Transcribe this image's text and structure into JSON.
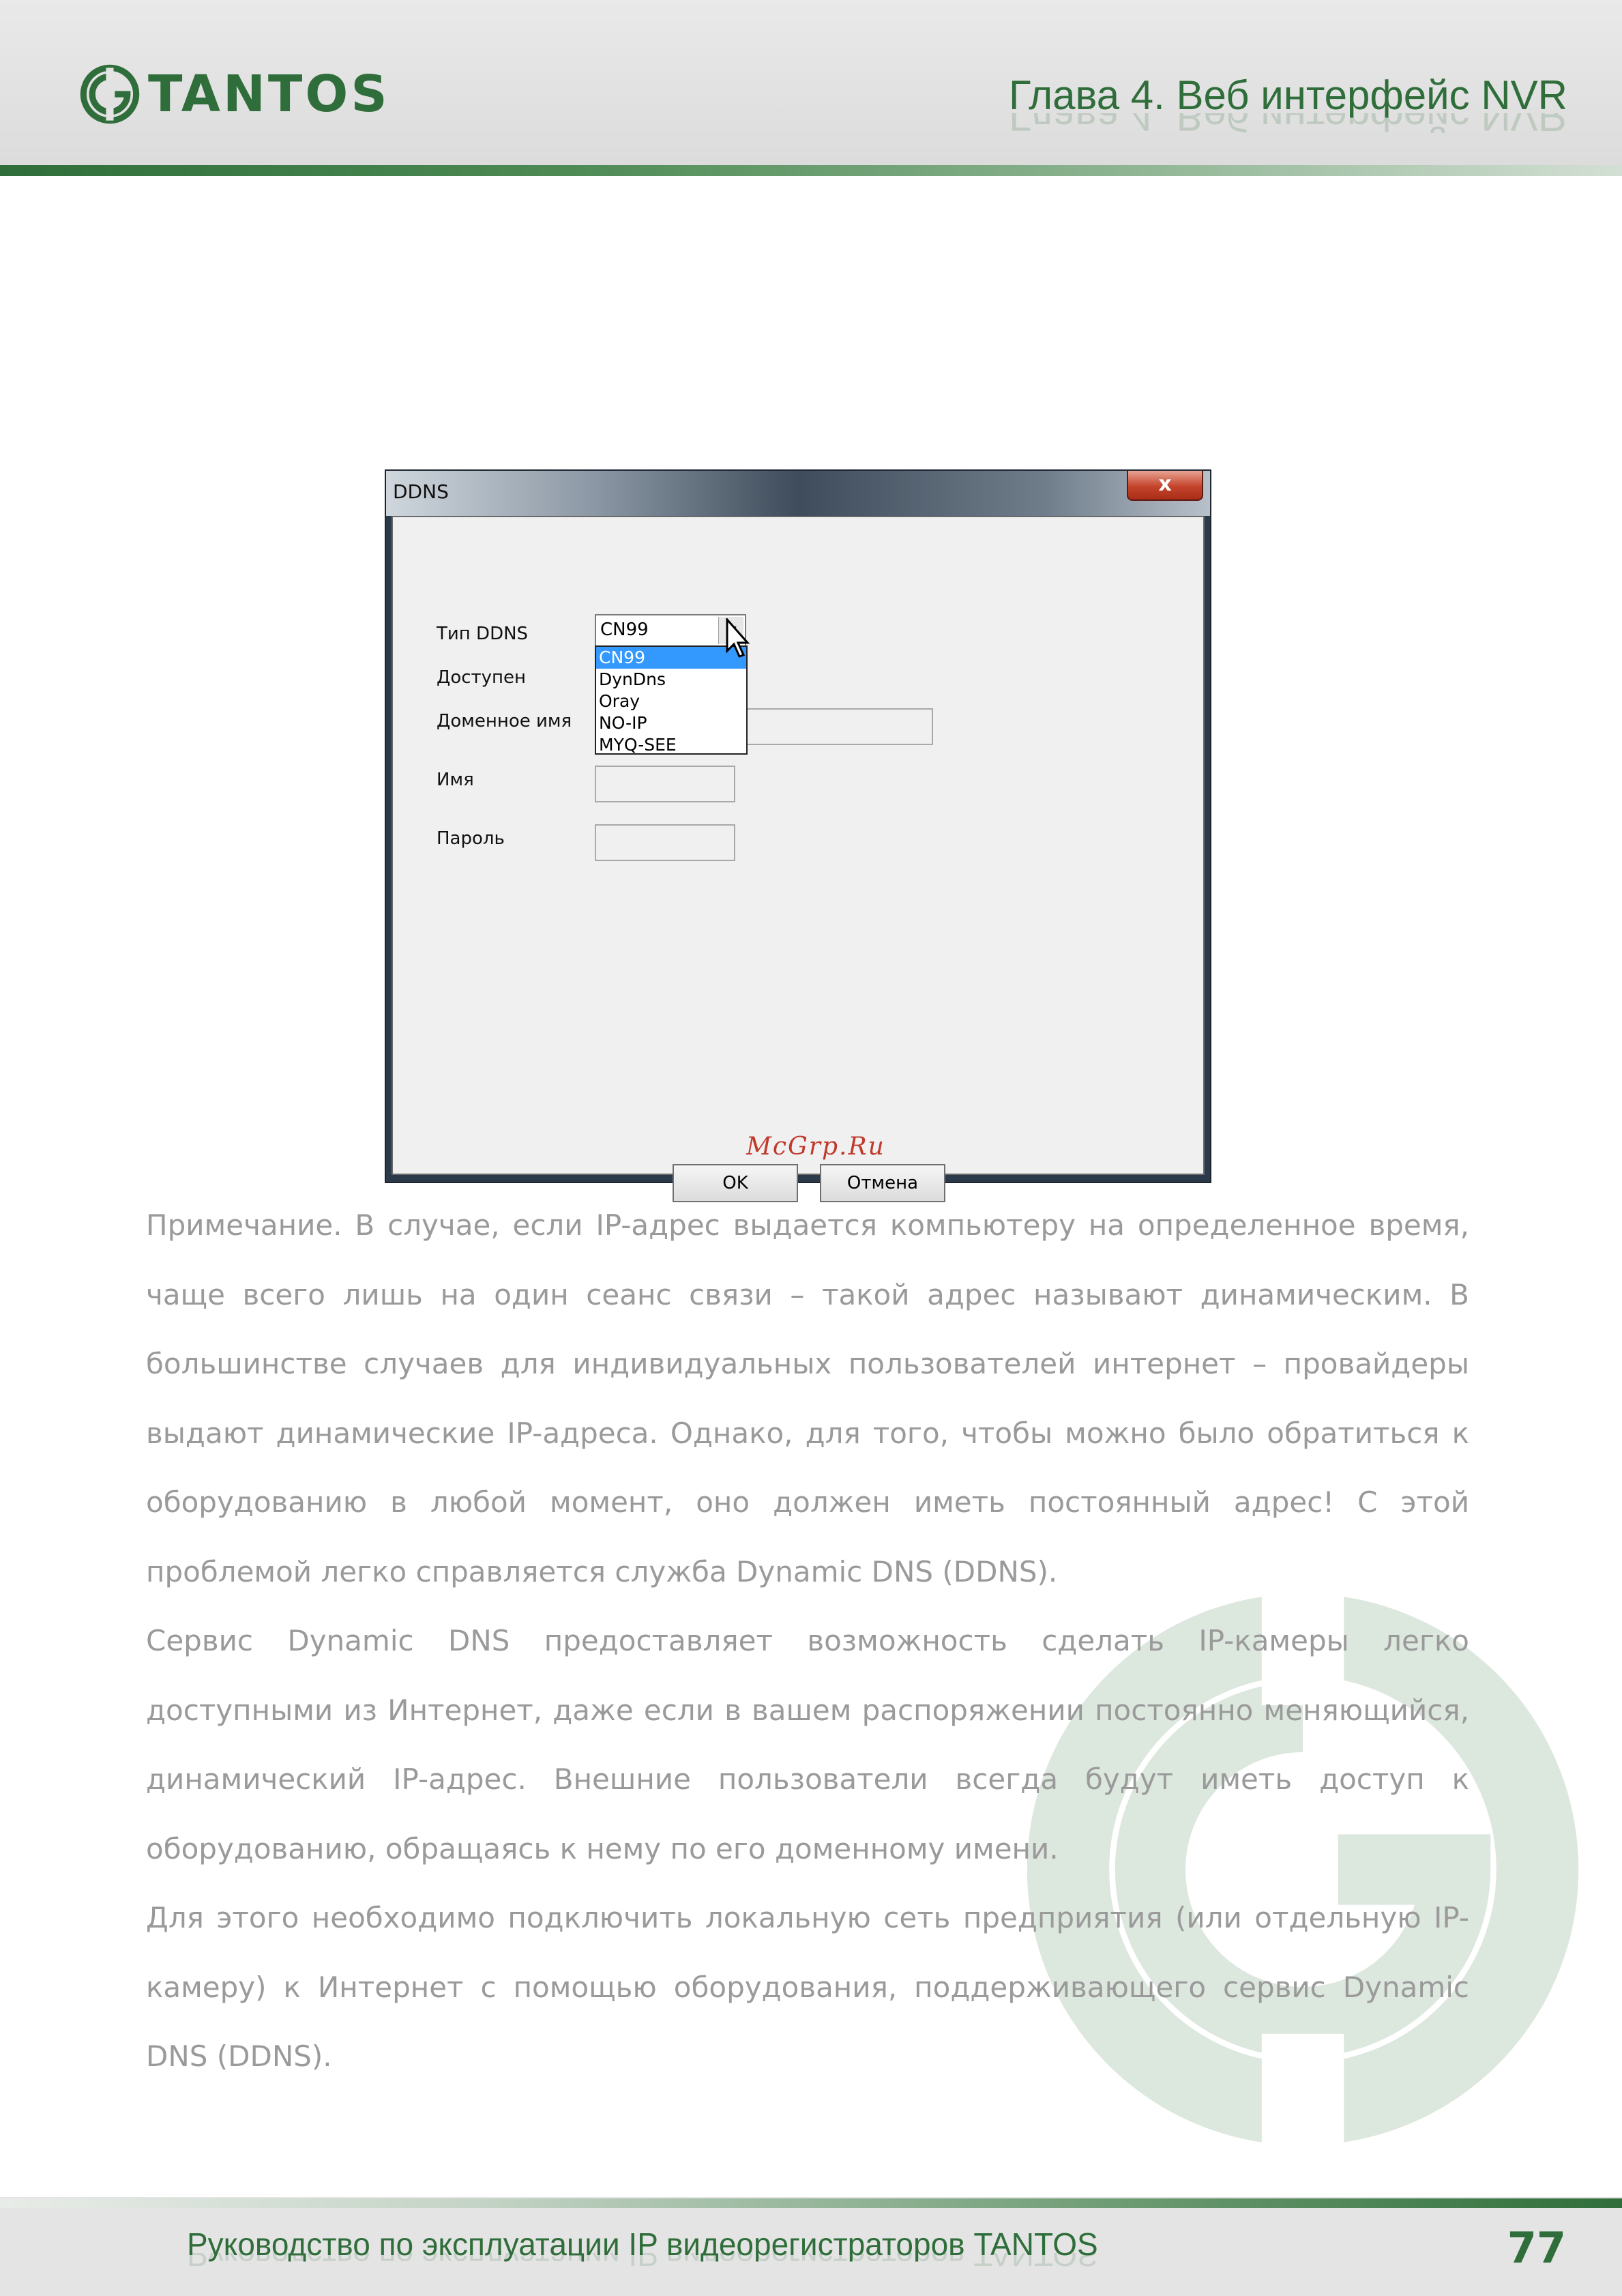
{
  "header": {
    "logo_text": "TANTOS",
    "chapter_title": "Глава 4. Веб интерфейс NVR"
  },
  "dialog": {
    "title": "DDNS",
    "close_label": "x",
    "fields": {
      "ddns_type_label": "Тип DDNS",
      "enabled_label": "Доступен",
      "domain_label": "Доменное имя",
      "name_label": "Имя",
      "password_label": "Пароль"
    },
    "select_value": "CN99",
    "dropdown_options": [
      "CN99",
      "DynDns",
      "Oray",
      "NO-IP",
      "MYQ-SEE"
    ],
    "ok_label": "OK",
    "cancel_label": "Отмена",
    "watermark": "McGrp.Ru"
  },
  "body": {
    "p1": "Примечание. В случае, если IP-адрес выдается компьютеру на определенное время, чаще всего лишь на один сеанс связи – такой адрес называют динамическим. В большинстве случаев для индивидуальных пользователей интернет – провайдеры выдают динамические IP-адреса. Однако, для того, чтобы можно было обратиться к оборудованию в любой момент, оно должен иметь постоянный адрес! С этой проблемой легко справляется служба Dynamic DNS (DDNS).",
    "p2": "Сервис Dynamic DNS предоставляет возможность сделать IP-камеры легко доступными из Интернет, даже если в вашем распоряжении постоянно меняющийся, динамический IP-адрес. Внешние пользователи всегда будут иметь доступ к оборудованию, обращаясь к нему по его доменному имени.",
    "p3": "Для этого необходимо подключить локальную сеть предприятия (или отдельную IP-камеру) к Интернет с помощью оборудования, поддерживающего сервис Dynamic DNS (DDNS)."
  },
  "footer": {
    "manual_title": "Руководство по эксплуатации IP видеорегистраторов TANTOS",
    "page_number": "77"
  },
  "colors": {
    "brand_green": "#2f6e3a",
    "text_gray": "#9a9a9a",
    "selection_blue": "#3399ff"
  }
}
